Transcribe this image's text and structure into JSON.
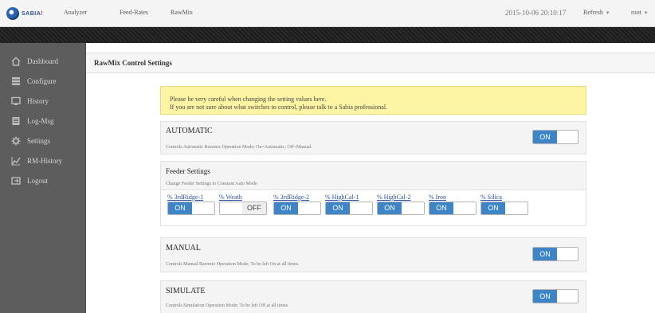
{
  "app": {
    "logo": "SABIA",
    "logo_accent": "/"
  },
  "nav": {
    "items": [
      "Analyzer",
      "Feed-Rates",
      "RawMix"
    ]
  },
  "header": {
    "datetime": "2015-10-06 20:10:17",
    "refresh_label": "Refresh",
    "user_label": "root"
  },
  "sidebar": {
    "items": [
      {
        "label": "Dashboard",
        "icon": "home-icon"
      },
      {
        "label": "Configure",
        "icon": "stack-icon"
      },
      {
        "label": "History",
        "icon": "monitor-icon"
      },
      {
        "label": "Log-Msg",
        "icon": "document-icon"
      },
      {
        "label": "Settings",
        "icon": "gear-icon"
      },
      {
        "label": "RM-History",
        "icon": "chart-icon"
      },
      {
        "label": "Logout",
        "icon": "logout-icon"
      }
    ]
  },
  "main": {
    "title": "RawMix Control Settings",
    "warning": [
      "Please be very careful when changing the setting values here.",
      "If you are not sure about what switches to control, please talk to a Sabia professional."
    ],
    "automatic": {
      "title": "AUTOMATIC",
      "desc": "Controls Automatic Rawmix Operation Mode; On=Automatic; Off=Manual.",
      "state": "ON"
    },
    "feeder": {
      "title": "Feeder Settings",
      "desc": "Change Feeder Settings to Constant Auto Mode",
      "items": [
        {
          "label": "% 3rdRidge-1",
          "state": "ON"
        },
        {
          "label": "% Weath",
          "state": "OFF"
        },
        {
          "label": "% 3rdRidge-2",
          "state": "ON"
        },
        {
          "label": "% HighCal-1",
          "state": "ON"
        },
        {
          "label": "% HighCal-2",
          "state": "ON"
        },
        {
          "label": "% Iron",
          "state": "ON"
        },
        {
          "label": "% Silica",
          "state": "ON"
        }
      ]
    },
    "manual": {
      "title": "MANUAL",
      "desc": "Controls Manual Rawmix Operation Mode; To be left On at all times.",
      "state": "ON"
    },
    "simulate": {
      "title": "SIMULATE",
      "desc": "Controls Simulation Operation Mode; To be left Off at all times.",
      "state": "ON"
    }
  },
  "colors": {
    "accent": "#3d85c6",
    "warning_bg": "#fdf4a4",
    "sidebar_bg": "#5d5d5d"
  }
}
